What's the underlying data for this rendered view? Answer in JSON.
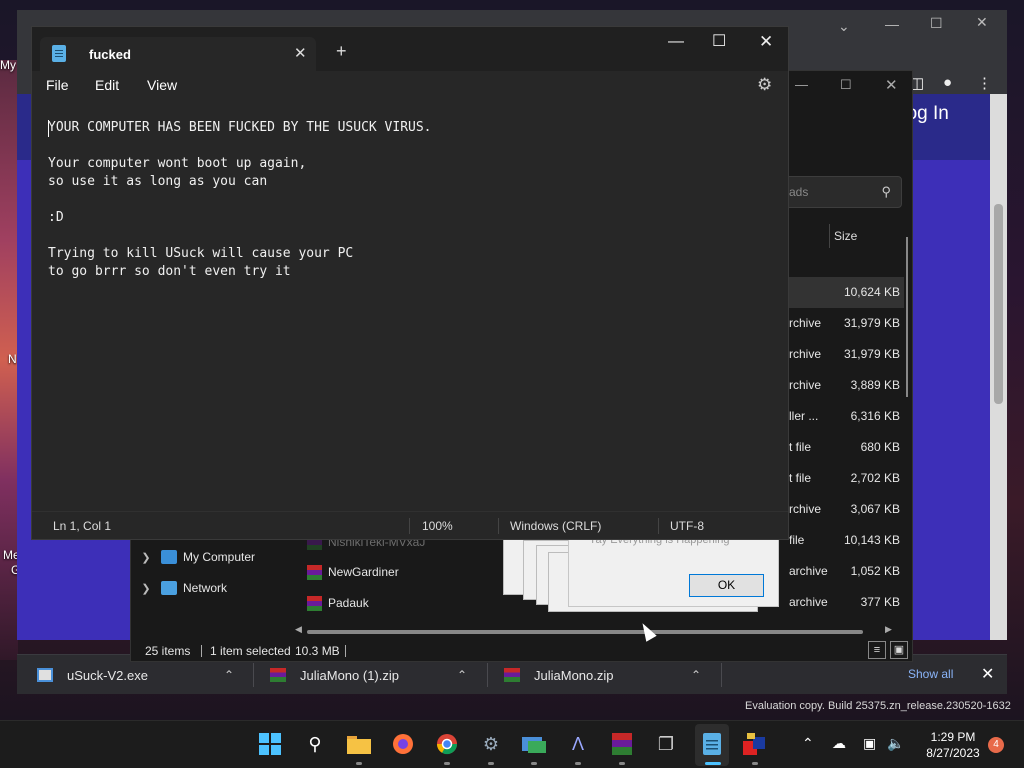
{
  "desktop": {
    "left_labels": [
      "My",
      "N",
      "Me",
      "G"
    ]
  },
  "browser": {
    "login_label": "Log In",
    "download_bar": {
      "items": [
        {
          "name": "uSuck-V2.exe"
        },
        {
          "name": "JuliaMono (1).zip"
        },
        {
          "name": "JuliaMono.zip"
        }
      ],
      "show_all": "Show all"
    }
  },
  "explorer": {
    "search_placeholder": "ads",
    "size_header": "Size",
    "rows": [
      {
        "type": "",
        "size": "10,624 KB"
      },
      {
        "type": "rchive",
        "size": "31,979 KB"
      },
      {
        "type": "rchive",
        "size": "31,979 KB"
      },
      {
        "type": "rchive",
        "size": "3,889 KB"
      },
      {
        "type": "ller ...",
        "size": "6,316 KB"
      },
      {
        "type": "t file",
        "size": "680 KB"
      },
      {
        "type": "t file",
        "size": "2,702 KB"
      },
      {
        "type": "rchive",
        "size": "3,067 KB"
      },
      {
        "type": "file",
        "size": "10,143 KB"
      },
      {
        "type": "archive",
        "size": "1,052 KB"
      },
      {
        "type": "archive",
        "size": "377 KB"
      }
    ],
    "tree": [
      {
        "label": "My Computer"
      },
      {
        "label": "Network"
      }
    ],
    "files": [
      "NishikiTeki-MVxaJ",
      "NewGardiner",
      "Padauk"
    ],
    "status": {
      "items": "25 items",
      "selected": "1 item selected",
      "size": "10.3 MB"
    }
  },
  "dialog": {
    "text": "Yay Everything is Happening",
    "ok_label": "OK"
  },
  "notepad": {
    "tab_title": "fucked",
    "menu": [
      "File",
      "Edit",
      "View"
    ],
    "lines": [
      "YOUR COMPUTER HAS BEEN FUCKED BY THE USUCK VIRUS.",
      "Your computer wont boot up again,",
      "so use it as long as you can",
      ":D",
      "Trying to kill USuck will cause your PC",
      "to go brrr so don't even try it"
    ],
    "status": {
      "position": "Ln 1, Col 1",
      "zoom": "100%",
      "line_ending": "Windows (CRLF)",
      "encoding": "UTF-8"
    }
  },
  "watermark": "Evaluation copy. Build 25375.zn_release.230520-1632",
  "taskbar": {
    "time": "1:29 PM",
    "date": "8/27/2023",
    "notifications": "4"
  }
}
